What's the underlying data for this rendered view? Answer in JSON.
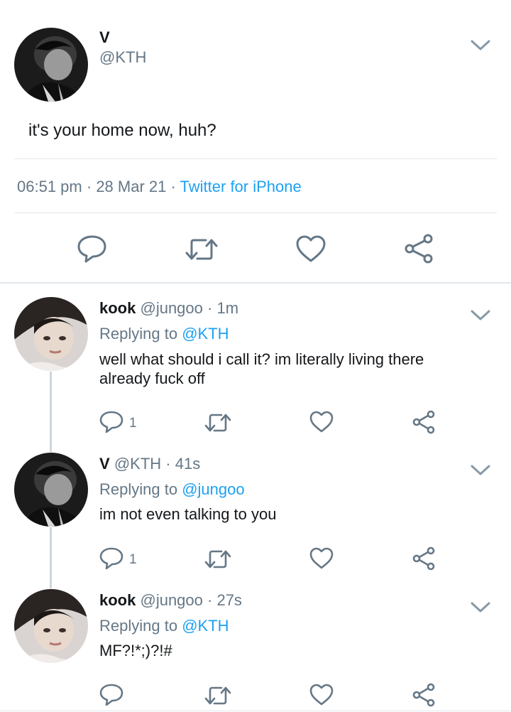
{
  "main_tweet": {
    "display_name": "V",
    "handle": "@KTH",
    "text": "it's your home now, huh?",
    "time": "06:51 pm",
    "date": "28 Mar 21",
    "source": "Twitter for iPhone",
    "dot": "·"
  },
  "replies": [
    {
      "display_name": "kook",
      "handle": "@jungoo",
      "age": "· 1m",
      "replying_prefix": "Replying to",
      "replying_to": "@KTH",
      "text_line1": "well what should i call it? im literally living there",
      "text_line2": "already fuck off",
      "reply_count": "1"
    },
    {
      "display_name": "V",
      "handle": "@KTH",
      "age": "· 41s",
      "replying_prefix": "Replying to",
      "replying_to": "@jungoo",
      "text_line1": "im not even talking to you",
      "reply_count": "1"
    },
    {
      "display_name": "kook",
      "handle": "@jungoo",
      "age": "· 27s",
      "replying_prefix": "Replying to",
      "replying_to": "@KTH",
      "text_line1": "MF?!*;)?!#"
    }
  ],
  "icons": [
    "reply-icon",
    "retweet-icon",
    "like-icon",
    "share-icon",
    "chevron-down-icon"
  ],
  "colors": {
    "link": "#1da1f2",
    "muted": "#657786",
    "icon": "#657786",
    "divider": "#e1e8ed"
  }
}
